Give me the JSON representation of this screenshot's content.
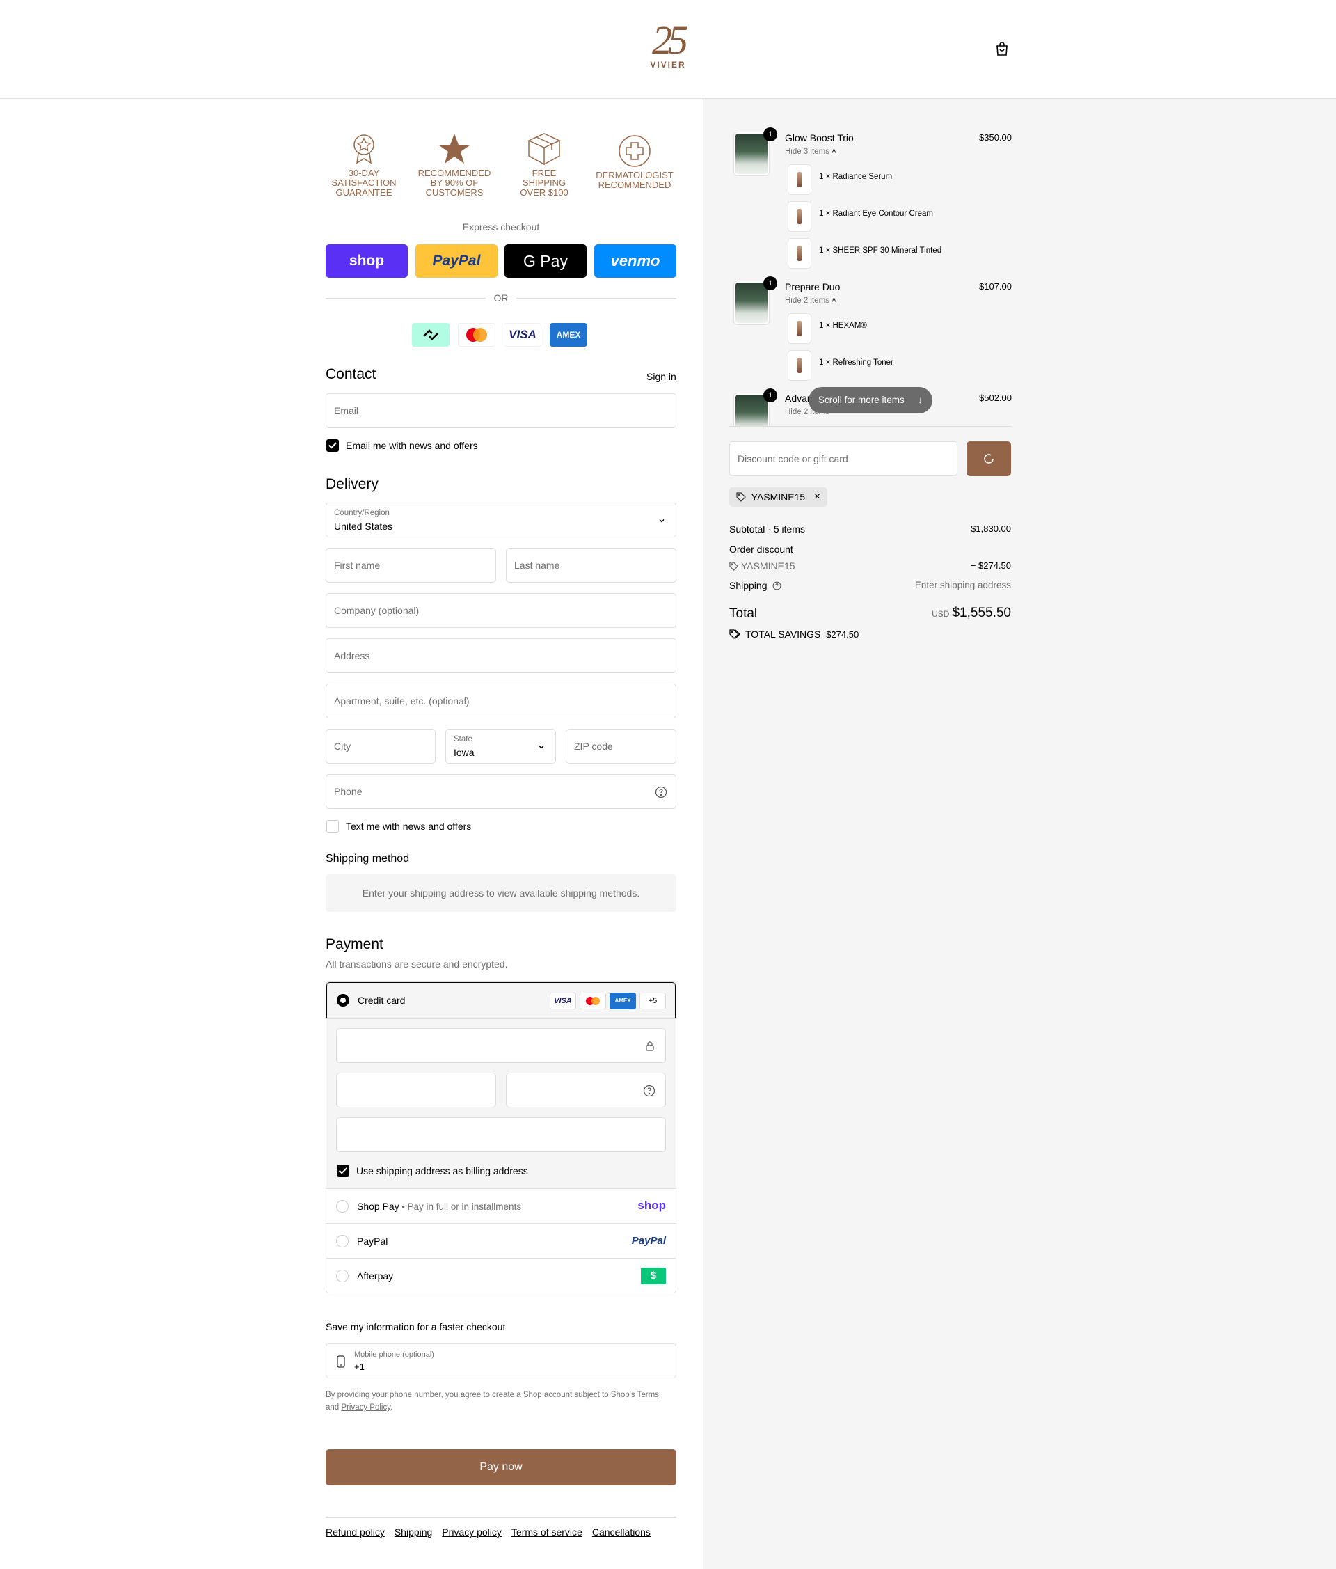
{
  "header": {
    "logo_number": "25",
    "logo_word": "VIVIER"
  },
  "trust_badges": [
    {
      "line1": "30-DAY",
      "line2": "SATISFACTION",
      "line3": "GUARANTEE"
    },
    {
      "line1": "RECOMMENDED",
      "line2": "BY 90% OF",
      "line3": "CUSTOMERS"
    },
    {
      "line1": "FREE",
      "line2": "SHIPPING",
      "line3": "OVER $100"
    },
    {
      "line1": "DERMATOLOGIST",
      "line2": "RECOMMENDED",
      "line3": ""
    }
  ],
  "express": {
    "label": "Express checkout",
    "buttons": [
      "shop",
      "PayPal",
      "G Pay",
      "venmo"
    ],
    "or": "OR"
  },
  "contact": {
    "title": "Contact",
    "sign_in": "Sign in",
    "email_placeholder": "Email",
    "email_optin": "Email me with news and offers"
  },
  "delivery": {
    "title": "Delivery",
    "country_label": "Country/Region",
    "country_value": "United States",
    "first_name": "First name",
    "last_name": "Last name",
    "company": "Company (optional)",
    "address": "Address",
    "apartment": "Apartment, suite, etc. (optional)",
    "city": "City",
    "state_label": "State",
    "state_value": "Iowa",
    "zip": "ZIP code",
    "phone": "Phone",
    "sms_optin": "Text me with news and offers"
  },
  "shipping_method": {
    "title": "Shipping method",
    "message": "Enter your shipping address to view available shipping methods."
  },
  "payment": {
    "title": "Payment",
    "subtitle": "All transactions are secure and encrypted.",
    "credit_card": "Credit card",
    "more_cards": "+5",
    "billing_same": "Use shipping address as billing address",
    "shop_pay": "Shop Pay",
    "shop_pay_sub": "Pay in full or in installments",
    "paypal": "PayPal",
    "afterpay": "Afterpay"
  },
  "save_info": {
    "title": "Save my information for a faster checkout",
    "phone_label": "Mobile phone (optional)",
    "phone_value": "+1",
    "legal_1": "By providing your phone number, you agree to create a Shop account subject to Shop's ",
    "terms": "Terms",
    "legal_2": "and ",
    "privacy": "Privacy Policy",
    "legal_3": "."
  },
  "pay_now": "Pay now",
  "footer_links": [
    "Refund policy",
    "Shipping",
    "Privacy policy",
    "Terms of service",
    "Cancellations"
  ],
  "cart": {
    "items": [
      {
        "name": "Glow Boost Trio",
        "qty": "1",
        "price": "$350.00",
        "toggle": "Hide 3 items",
        "sub": [
          "1 × Radiance Serum",
          "1 × Radiant Eye Contour Cream",
          "1 × SHEER SPF 30 Mineral Tinted"
        ]
      },
      {
        "name": "Prepare Duo",
        "qty": "1",
        "price": "$107.00",
        "toggle": "Hide 2 items",
        "sub": [
          "1 × HEXAM®",
          "1 × Refreshing Toner"
        ]
      },
      {
        "name": "Advan",
        "qty": "1",
        "price": "$502.00",
        "toggle": "Hide 2 items",
        "sub": []
      }
    ],
    "scroll_hint": "Scroll for more items",
    "discount_placeholder": "Discount code or gift card",
    "applied_code": "YASMINE15",
    "subtotal_label": "Subtotal · 5 items",
    "subtotal_value": "$1,830.00",
    "order_discount_label": "Order discount",
    "discount_code": "YASMINE15",
    "discount_value": "− $274.50",
    "shipping_label": "Shipping",
    "shipping_value": "Enter shipping address",
    "total_label": "Total",
    "currency": "USD",
    "total_value": "$1,555.50",
    "savings_label": "TOTAL SAVINGS",
    "savings_value": "$274.50"
  },
  "colors": {
    "brand_brown": "#946448",
    "shop_purple": "#5a31f4",
    "paypal_yellow": "#ffc439",
    "venmo_blue": "#008cff",
    "afterpay_green": "#0ac77a"
  }
}
